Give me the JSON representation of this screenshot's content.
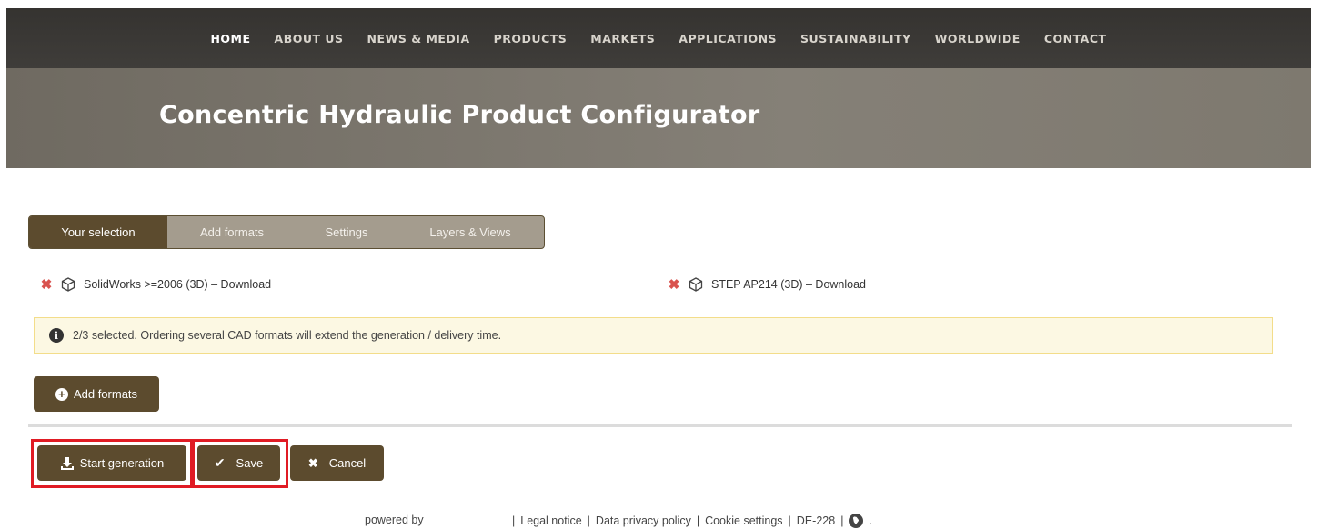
{
  "nav": {
    "items": [
      "HOME",
      "ABOUT US",
      "NEWS & MEDIA",
      "PRODUCTS",
      "MARKETS",
      "APPLICATIONS",
      "SUSTAINABILITY",
      "WORLDWIDE",
      "CONTACT"
    ],
    "active": "HOME"
  },
  "hero": {
    "title": "Concentric Hydraulic Product Configurator"
  },
  "tabs": [
    "Your selection",
    "Add formats",
    "Settings",
    "Layers & Views"
  ],
  "formats": [
    {
      "label": "SolidWorks >=2006 (3D) – Download",
      "remove_icon": "close-x-icon",
      "type_icon": "cube-icon"
    },
    {
      "label": "STEP AP214 (3D) – Download",
      "remove_icon": "close-x-icon",
      "type_icon": "cube-icon"
    }
  ],
  "alert": {
    "text": "2/3 selected.  Ordering several CAD formats will extend the generation / delivery time.",
    "icon": "info-icon"
  },
  "buttons": {
    "add_formats": "Add formats",
    "start_generation": "Start generation",
    "save": "Save",
    "cancel": "Cancel"
  },
  "footer": {
    "powered_by": "powered by",
    "separator": "|",
    "legal_notice": "Legal notice",
    "privacy": "Data privacy policy",
    "cookies": "Cookie settings",
    "code": "DE-228",
    "trailing": "."
  },
  "colors": {
    "brand": "#5c4b2e",
    "tab_bg": "#a49c8e",
    "nav_bg": "#353330",
    "alert_bg": "#fcf8e3",
    "remove": "#d9534f",
    "highlight": "#e01b24"
  }
}
